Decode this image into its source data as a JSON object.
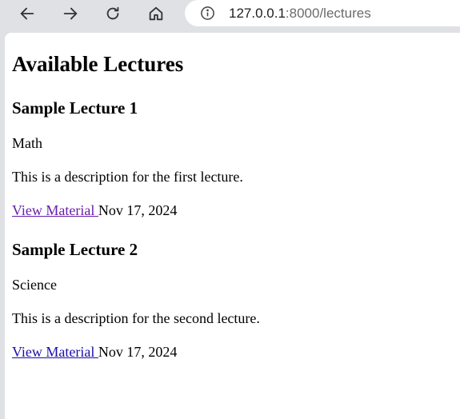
{
  "browser": {
    "url_host": "127.0.0.1",
    "url_path": ":8000/lectures",
    "icons": {
      "back": "back-arrow-icon",
      "forward": "forward-arrow-icon",
      "reload": "reload-icon",
      "home": "home-icon",
      "site_info": "info-icon"
    }
  },
  "page": {
    "title": "Available Lectures",
    "lectures": [
      {
        "title": "Sample Lecture 1",
        "subject": "Math",
        "description": "This is a description for the first lecture.",
        "link_label": "View Material ",
        "date": "Nov 17, 2024"
      },
      {
        "title": "Sample Lecture 2",
        "subject": "Science",
        "description": "This is a description for the second lecture.",
        "link_label": "View Material ",
        "date": "Nov 17, 2024"
      }
    ]
  },
  "colors": {
    "chrome_bg": "#dfe1e5",
    "link": "#1a0dab",
    "link_visited": "#681da8"
  }
}
